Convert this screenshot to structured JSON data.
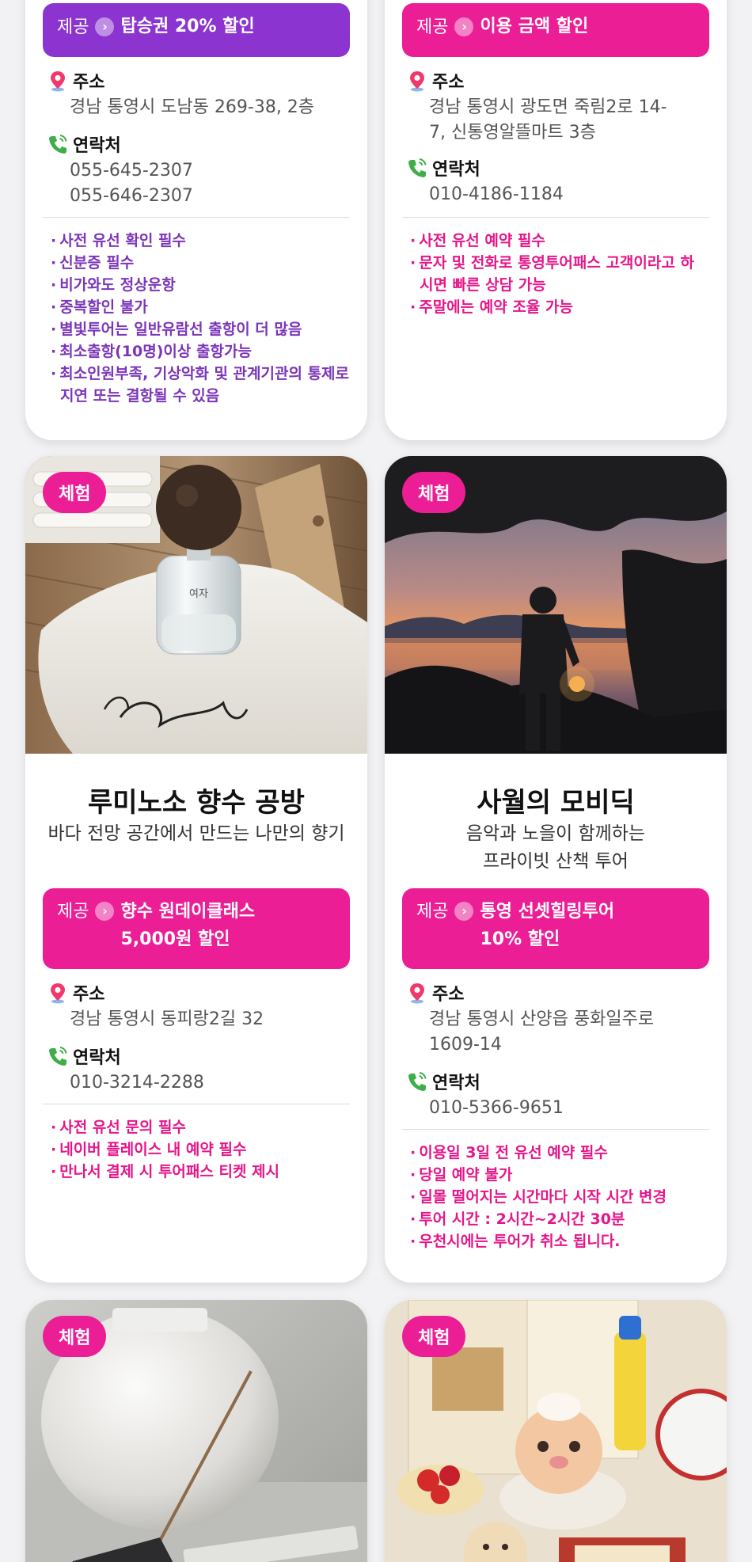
{
  "cards": [
    {
      "offer": {
        "label": "제공",
        "text": "탑승권 20% 할인"
      },
      "address_label": "주소",
      "address": "경남 통영시 도남동 269-38, 2층",
      "contact_label": "연락처",
      "contacts": [
        "055-645-2307",
        "055-646-2307"
      ],
      "notes": [
        "사전 유선 확인 필수",
        "신분증 필수",
        "비가와도 정상운항",
        "중복할인 불가",
        "별빛투어는 일반유람선 출항이 더 많음",
        "최소출항(10명)이상 출항가능",
        "최소인원부족, 기상악화 및 관계기관의 통제로 지연 또는 결항될 수 있음"
      ],
      "color": "#8b34cf"
    },
    {
      "offer": {
        "label": "제공",
        "text": "이용 금액 할인"
      },
      "address_label": "주소",
      "address": "경남 통영시 광도면 죽림2로 14-7, 신통영알뜰마트 3층",
      "contact_label": "연락처",
      "contacts": [
        "010-4186-1184"
      ],
      "notes": [
        "사전 유선 예약 필수",
        "문자 및 전화로 통영투어패스 고객이라고 하시면 빠른 상담 가능",
        "주말에는 예약 조율 가능"
      ],
      "color": "#ec1e96"
    },
    {
      "tag": "체험",
      "title": "루미노소 향수 공방",
      "subtitle": "바다 전망 공간에서 만드는 나만의 향기",
      "offer": {
        "label": "제공",
        "text1": "향수 원데이클래스",
        "text2": "5,000원 할인"
      },
      "address_label": "주소",
      "address": "경남 통영시 동피랑2길 32",
      "contact_label": "연락처",
      "contacts": [
        "010-3214-2288"
      ],
      "notes": [
        "사전 유선 문의 필수",
        "네이버 플레이스 내 예약 필수",
        "만나서 결제 시 투어패스 티켓 제시"
      ],
      "bottle_label": "여자",
      "color": "#ec1e96"
    },
    {
      "tag": "체험",
      "title": "사월의 모비딕",
      "subtitle1": "음악과 노을이 함께하는",
      "subtitle2": "프라이빗 산책 투어",
      "offer": {
        "label": "제공",
        "text1": "통영 선셋힐링투어",
        "text2": "10% 할인"
      },
      "address_label": "주소",
      "address": "경남 통영시 산양읍 풍화일주로 1609-14",
      "contact_label": "연락처",
      "contacts": [
        "010-5366-9651"
      ],
      "notes": [
        "이용일 3일 전 유선 예약 필수",
        "당일 예약 불가",
        "일몰 떨어지는 시간마다 시작 시간 변경",
        "투어 시간 : 2시간~2시간 30분",
        "우천시에는 투어가 취소 됩니다."
      ],
      "color": "#ec1e96"
    },
    {
      "tag": "체험"
    },
    {
      "tag": "체험"
    }
  ]
}
